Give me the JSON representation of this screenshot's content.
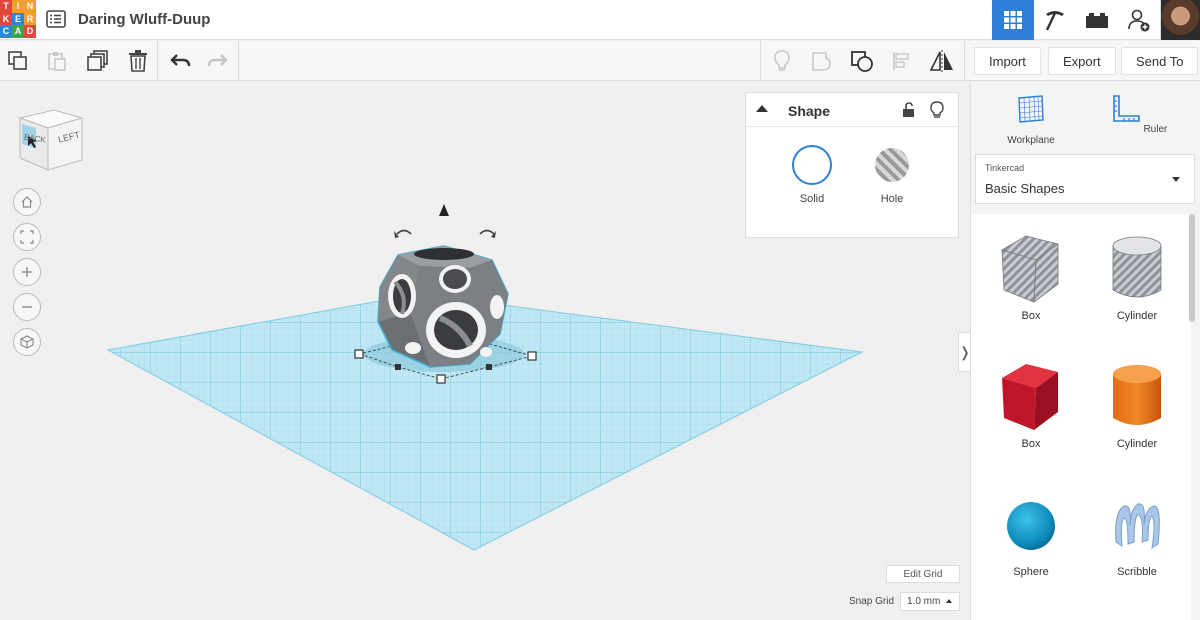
{
  "app": {
    "logo_letters": [
      "T",
      "I",
      "N",
      "K",
      "E",
      "R",
      "C",
      "A",
      "D"
    ],
    "logo_colors": [
      "#e2473b",
      "#f2a02b",
      "#f2a02b",
      "#e2473b",
      "#2f86d1",
      "#f2a02b",
      "#2f86d1",
      "#3aa74a",
      "#e2473b"
    ],
    "document_title": "Daring Wluff-Duup"
  },
  "topbar": {
    "icons": [
      "grid-view-icon",
      "pickaxe-icon",
      "bricks-icon",
      "add-user-icon",
      "avatar"
    ],
    "active_color": "#2d7fd8"
  },
  "toolbar": {
    "import_label": "Import",
    "export_label": "Export",
    "sendto_label": "Send To"
  },
  "viewcube": {
    "front_label": "BACK",
    "side_label": "LEFT"
  },
  "shape_panel": {
    "title": "Shape",
    "solid_label": "Solid",
    "hole_label": "Hole"
  },
  "grid": {
    "edit_grid_label": "Edit Grid",
    "snap_grid_label": "Snap Grid",
    "snap_value": "1.0 mm"
  },
  "right_panel": {
    "workplane_label": "Workplane",
    "ruler_label": "Ruler",
    "library_group": "Tinkercad",
    "library_name": "Basic Shapes",
    "shapes": [
      {
        "name": "Box",
        "kind": "box-hole"
      },
      {
        "name": "Cylinder",
        "kind": "cylinder-hole"
      },
      {
        "name": "Box",
        "kind": "box-red"
      },
      {
        "name": "Cylinder",
        "kind": "cylinder-orange"
      },
      {
        "name": "Sphere",
        "kind": "sphere-blue"
      },
      {
        "name": "Scribble",
        "kind": "scribble"
      }
    ]
  }
}
